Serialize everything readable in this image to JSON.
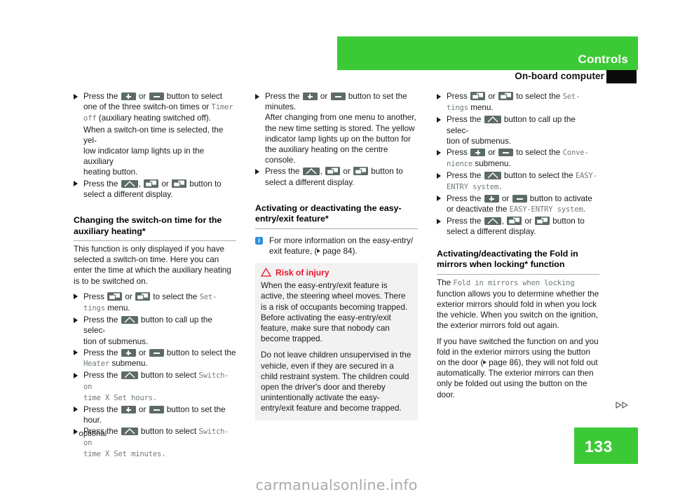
{
  "header": {
    "chapter": "Controls",
    "section": "On-board computer"
  },
  "col1": {
    "step1": {
      "pre": "Press the",
      "mid": "or",
      "post": "button to select",
      "line2a": "one of the three switch-on times or",
      "disp1": "Timer",
      "disp2": "off",
      "line3b": "(auxiliary heating switched off).",
      "line4": "When a switch-on time is selected, the yel-",
      "line5": "low indicator lamp lights up in the auxiliary",
      "line6": "heating button."
    },
    "step2": {
      "pre": "Press the",
      "comma": ",",
      "mid": "or",
      "post": "button to",
      "line2": "select a different display."
    },
    "heading": "Changing the switch-on time for the auxiliary heating*",
    "intro": "This function is only displayed if you have selected a switch-on time. Here you can enter the time at which the auxiliary heating is to be switched on.",
    "step3": {
      "pre": "Press",
      "mid": "or",
      "post": "to select the",
      "disp1": "Set-",
      "disp2": "tings",
      "line2b": "menu."
    },
    "step4": {
      "pre": "Press the",
      "post": "button to call up the selec-",
      "line2": "tion of submenus."
    },
    "step5": {
      "pre": "Press the",
      "mid": "or",
      "post": "button to select the",
      "disp": "Heater",
      "line2b": "submenu."
    },
    "step6": {
      "pre": "Press the",
      "post": "button to select",
      "disp1": "Switch-on",
      "disp2": "time X Set hours."
    },
    "step7": {
      "pre": "Press the",
      "mid": "or",
      "post": "button to set the",
      "line2": "hour."
    },
    "step8": {
      "pre": "Press the",
      "post": "button to select",
      "disp1": "Switch-on",
      "disp2": "time X Set minutes."
    }
  },
  "col2": {
    "step1": {
      "pre": "Press the",
      "mid": "or",
      "post": "button to set the",
      "line2": "minutes.",
      "line3": "After changing from one menu to another,",
      "line4": "the new time setting is stored. The yellow",
      "line5": "indicator lamp lights up on the button for",
      "line6": "the auxiliary heating on the centre console."
    },
    "step2": {
      "pre": "Press the",
      "comma": ",",
      "mid": "or",
      "post": "button to",
      "line2": "select a different display."
    },
    "heading": "Activating or deactivating the easy-entry/exit feature*",
    "note": {
      "line1": "For more information on the easy-entry/",
      "line2a": "exit feature, (",
      "line2b": "page 84)."
    },
    "warning": {
      "title": "Risk of injury",
      "p1": "When the easy-entry/exit feature is active, the steering wheel moves. There is a risk of occupants becoming trapped. Before activating the easy-entry/exit feature, make sure that nobody can become trapped.",
      "p2": "Do not leave children unsupervised in the vehicle, even if they are secured in a child restraint system. The children could open the driver's door and thereby unintentionally activate the easy-entry/exit feature and become trapped."
    }
  },
  "col3": {
    "step1": {
      "pre": "Press",
      "mid": "or",
      "post": "to select the",
      "disp1": "Set-",
      "disp2": "tings",
      "line2b": "menu."
    },
    "step2": {
      "pre": "Press the",
      "post": "button to call up the selec-",
      "line2": "tion of submenus."
    },
    "step3": {
      "pre": "Press",
      "mid": "or",
      "post": "to select the",
      "disp1": "Conve-",
      "disp2": "nience",
      "line2b": "submenu."
    },
    "step4": {
      "pre": "Press the",
      "post": "button to select the",
      "disp1": "EASY-",
      "disp2": "ENTRY system."
    },
    "step5": {
      "pre": "Press the",
      "mid": "or",
      "post": "button to activate",
      "line2a": "or deactivate the",
      "disp": "EASY-ENTRY system",
      "line2b": "."
    },
    "step6": {
      "pre": "Press the",
      "comma": ",",
      "mid": "or",
      "post": "button to",
      "line2": "select a different display."
    },
    "heading": "Activating/deactivating the Fold in mirrors when locking* function",
    "para1a": "The",
    "para1disp": "Fold in mirrors when locking",
    "para1b": "function allows you to determine whether the exterior mirrors should fold in when you lock the vehicle. When you switch on the ignition, the exterior mirrors fold out again.",
    "para2a": "If you have switched the function on and you fold in the exterior mirrors using the button on the door (",
    "para2b": "page 86), they will not fold out automatically. The exterior mirrors can then only be folded out using the button on the door."
  },
  "footer": {
    "footnote": "* optional",
    "page_number": "133",
    "watermark": "carmanualsonline.info"
  },
  "colors": {
    "brand_green": "#3cc936",
    "warning_red": "#e8142d",
    "info_blue": "#2a8fd8",
    "display_gray": "#6f7b78",
    "button_gray": "#5d6b68"
  }
}
